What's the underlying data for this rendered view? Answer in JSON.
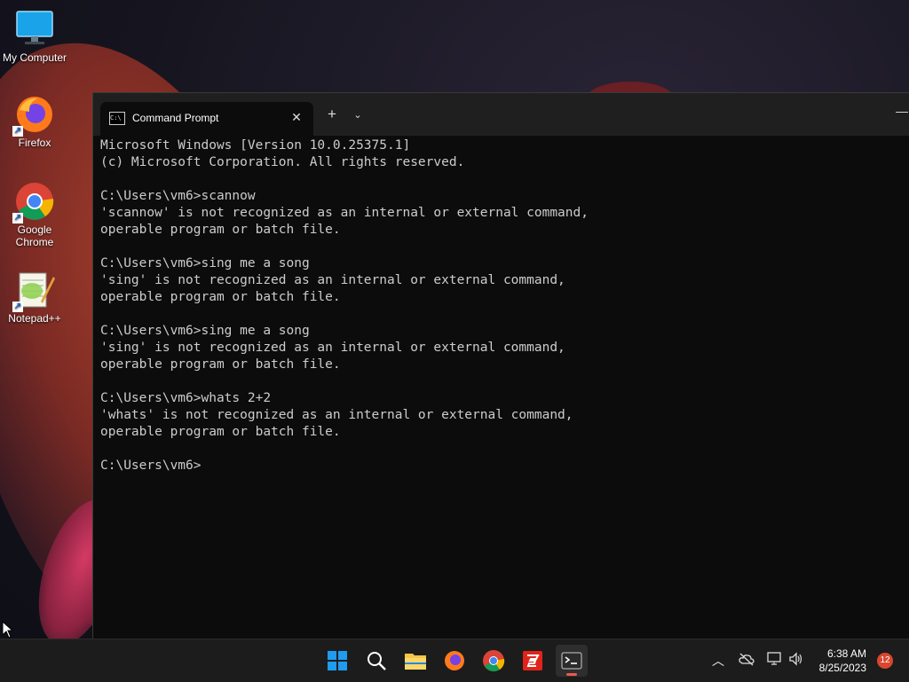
{
  "desktop": {
    "icons": [
      {
        "label": "My Computer"
      },
      {
        "label": "Firefox"
      },
      {
        "label": "Google\nChrome"
      },
      {
        "label": "Notepad++"
      }
    ]
  },
  "window": {
    "tab_title": "Command Prompt",
    "console_lines": [
      "Microsoft Windows [Version 10.0.25375.1]",
      "(c) Microsoft Corporation. All rights reserved.",
      "",
      "C:\\Users\\vm6>scannow",
      "'scannow' is not recognized as an internal or external command,",
      "operable program or batch file.",
      "",
      "C:\\Users\\vm6>sing me a song",
      "'sing' is not recognized as an internal or external command,",
      "operable program or batch file.",
      "",
      "C:\\Users\\vm6>sing me a song",
      "'sing' is not recognized as an internal or external command,",
      "operable program or batch file.",
      "",
      "C:\\Users\\vm6>whats 2+2",
      "'whats' is not recognized as an internal or external command,",
      "operable program or batch file.",
      "",
      "C:\\Users\\vm6>"
    ]
  },
  "taskbar": {
    "time": "6:38 AM",
    "date": "8/25/2023",
    "notification_count": "12"
  },
  "colors": {
    "accent": "#e85a50",
    "taskbar_bg": "#1c1c1c",
    "console_bg": "#0c0c0c",
    "console_text": "#cccccc"
  }
}
